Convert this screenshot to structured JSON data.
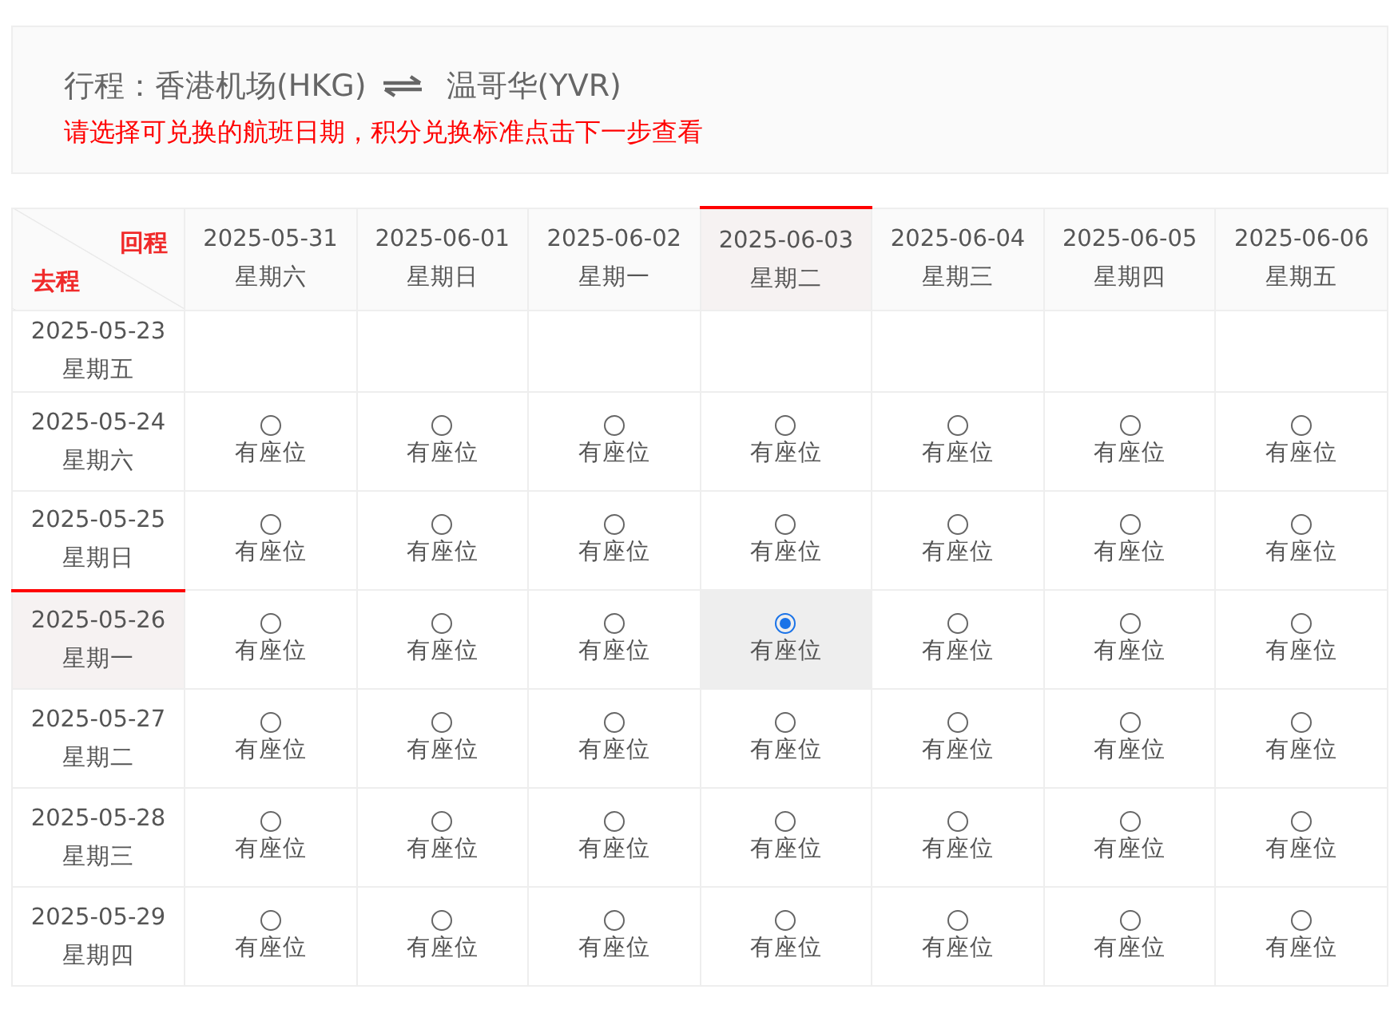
{
  "route": {
    "label": "行程：",
    "origin": "香港机场(HKG)",
    "destination": "温哥华(YVR)"
  },
  "notice": "请选择可兑换的航班日期，积分兑换标准点击下一步查看",
  "table": {
    "corner": {
      "return_label": "回程",
      "outbound_label": "去程"
    },
    "columns": [
      {
        "date": "2025-05-31",
        "weekday": "星期六",
        "selected": false
      },
      {
        "date": "2025-06-01",
        "weekday": "星期日",
        "selected": false
      },
      {
        "date": "2025-06-02",
        "weekday": "星期一",
        "selected": false
      },
      {
        "date": "2025-06-03",
        "weekday": "星期二",
        "selected": true
      },
      {
        "date": "2025-06-04",
        "weekday": "星期三",
        "selected": false
      },
      {
        "date": "2025-06-05",
        "weekday": "星期四",
        "selected": false
      },
      {
        "date": "2025-06-06",
        "weekday": "星期五",
        "selected": false
      }
    ],
    "rows": [
      {
        "date": "2025-05-23",
        "weekday": "星期五",
        "selected": false
      },
      {
        "date": "2025-05-24",
        "weekday": "星期六",
        "selected": false,
        "cells": [
          {
            "text": "有座位",
            "selected": false
          },
          {
            "text": "有座位",
            "selected": false
          },
          {
            "text": "有座位",
            "selected": false
          },
          {
            "text": "有座位",
            "selected": false
          },
          {
            "text": "有座位",
            "selected": false
          },
          {
            "text": "有座位",
            "selected": false
          },
          {
            "text": "有座位",
            "selected": false
          }
        ]
      },
      {
        "date": "2025-05-25",
        "weekday": "星期日",
        "selected": false,
        "cells": [
          {
            "text": "有座位",
            "selected": false
          },
          {
            "text": "有座位",
            "selected": false
          },
          {
            "text": "有座位",
            "selected": false
          },
          {
            "text": "有座位",
            "selected": false
          },
          {
            "text": "有座位",
            "selected": false
          },
          {
            "text": "有座位",
            "selected": false
          },
          {
            "text": "有座位",
            "selected": false
          }
        ]
      },
      {
        "date": "2025-05-26",
        "weekday": "星期一",
        "selected": true,
        "cells": [
          {
            "text": "有座位",
            "selected": false
          },
          {
            "text": "有座位",
            "selected": false
          },
          {
            "text": "有座位",
            "selected": false
          },
          {
            "text": "有座位",
            "selected": true
          },
          {
            "text": "有座位",
            "selected": false
          },
          {
            "text": "有座位",
            "selected": false
          },
          {
            "text": "有座位",
            "selected": false
          }
        ]
      },
      {
        "date": "2025-05-27",
        "weekday": "星期二",
        "selected": false,
        "cells": [
          {
            "text": "有座位",
            "selected": false
          },
          {
            "text": "有座位",
            "selected": false
          },
          {
            "text": "有座位",
            "selected": false
          },
          {
            "text": "有座位",
            "selected": false
          },
          {
            "text": "有座位",
            "selected": false
          },
          {
            "text": "有座位",
            "selected": false
          },
          {
            "text": "有座位",
            "selected": false
          }
        ]
      },
      {
        "date": "2025-05-28",
        "weekday": "星期三",
        "selected": false,
        "cells": [
          {
            "text": "有座位",
            "selected": false
          },
          {
            "text": "有座位",
            "selected": false
          },
          {
            "text": "有座位",
            "selected": false
          },
          {
            "text": "有座位",
            "selected": false
          },
          {
            "text": "有座位",
            "selected": false
          },
          {
            "text": "有座位",
            "selected": false
          },
          {
            "text": "有座位",
            "selected": false
          }
        ]
      },
      {
        "date": "2025-05-29",
        "weekday": "星期四",
        "selected": false,
        "cells": [
          {
            "text": "有座位",
            "selected": false
          },
          {
            "text": "有座位",
            "selected": false
          },
          {
            "text": "有座位",
            "selected": false
          },
          {
            "text": "有座位",
            "selected": false
          },
          {
            "text": "有座位",
            "selected": false
          },
          {
            "text": "有座位",
            "selected": false
          },
          {
            "text": "有座位",
            "selected": false
          }
        ]
      }
    ]
  }
}
